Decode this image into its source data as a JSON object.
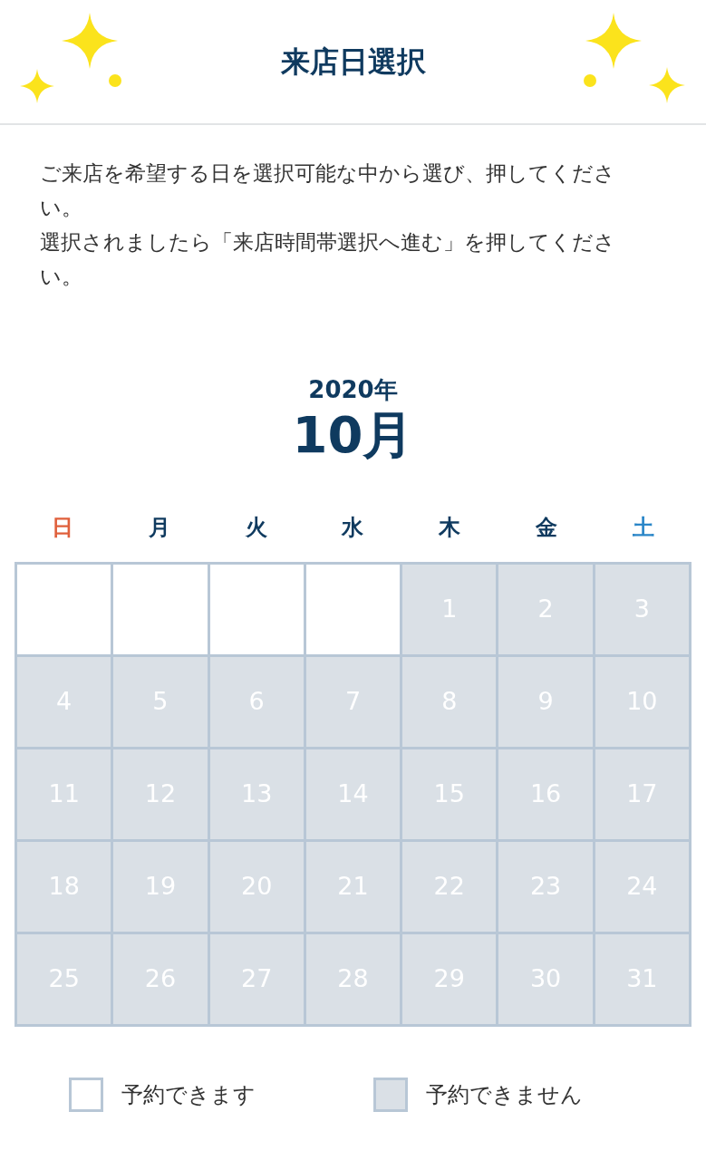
{
  "header": {
    "title": "来店日選択"
  },
  "instructions": [
    "ご来店を希望する日を選択可能な中から選び、押してください。",
    "選択されましたら「来店時間帯選択へ進む」を押してください。"
  ],
  "calendar": {
    "year": "2020年",
    "month": "10月",
    "weekdays": [
      {
        "label": "日",
        "kind": "sunday"
      },
      {
        "label": "月",
        "kind": "weekday"
      },
      {
        "label": "火",
        "kind": "weekday"
      },
      {
        "label": "水",
        "kind": "weekday"
      },
      {
        "label": "木",
        "kind": "weekday"
      },
      {
        "label": "金",
        "kind": "weekday"
      },
      {
        "label": "土",
        "kind": "saturday"
      }
    ],
    "days": [
      {
        "kind": "empty"
      },
      {
        "kind": "empty"
      },
      {
        "kind": "empty"
      },
      {
        "kind": "empty"
      },
      {
        "kind": "day",
        "label": "1",
        "available": false
      },
      {
        "kind": "day",
        "label": "2",
        "available": false
      },
      {
        "kind": "day",
        "label": "3",
        "available": false
      },
      {
        "kind": "day",
        "label": "4",
        "available": false
      },
      {
        "kind": "day",
        "label": "5",
        "available": false
      },
      {
        "kind": "day",
        "label": "6",
        "available": false
      },
      {
        "kind": "day",
        "label": "7",
        "available": false
      },
      {
        "kind": "day",
        "label": "8",
        "available": false
      },
      {
        "kind": "day",
        "label": "9",
        "available": false
      },
      {
        "kind": "day",
        "label": "10",
        "available": false
      },
      {
        "kind": "day",
        "label": "11",
        "available": false
      },
      {
        "kind": "day",
        "label": "12",
        "available": false
      },
      {
        "kind": "day",
        "label": "13",
        "available": false
      },
      {
        "kind": "day",
        "label": "14",
        "available": false
      },
      {
        "kind": "day",
        "label": "15",
        "available": false
      },
      {
        "kind": "day",
        "label": "16",
        "available": false
      },
      {
        "kind": "day",
        "label": "17",
        "available": false
      },
      {
        "kind": "day",
        "label": "18",
        "available": false
      },
      {
        "kind": "day",
        "label": "19",
        "available": false
      },
      {
        "kind": "day",
        "label": "20",
        "available": false
      },
      {
        "kind": "day",
        "label": "21",
        "available": false
      },
      {
        "kind": "day",
        "label": "22",
        "available": false
      },
      {
        "kind": "day",
        "label": "23",
        "available": false
      },
      {
        "kind": "day",
        "label": "24",
        "available": false
      },
      {
        "kind": "day",
        "label": "25",
        "available": false
      },
      {
        "kind": "day",
        "label": "26",
        "available": false
      },
      {
        "kind": "day",
        "label": "27",
        "available": false
      },
      {
        "kind": "day",
        "label": "28",
        "available": false
      },
      {
        "kind": "day",
        "label": "29",
        "available": false
      },
      {
        "kind": "day",
        "label": "30",
        "available": false
      },
      {
        "kind": "day",
        "label": "31",
        "available": false
      }
    ]
  },
  "legend": [
    {
      "label": "予約できます",
      "available": true
    },
    {
      "label": "予約できません",
      "available": false
    }
  ]
}
